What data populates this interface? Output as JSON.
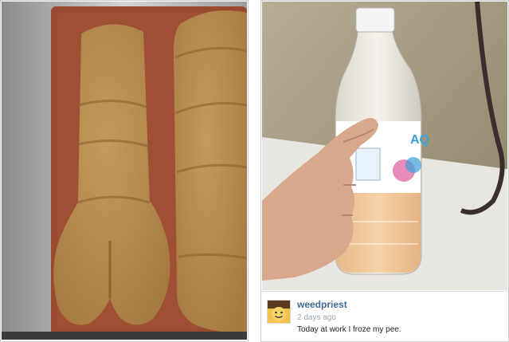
{
  "left_image": {
    "icon": "bread-loaves-photo",
    "colors": {
      "background": "#b9b9b9",
      "tray": "#9a4a2e",
      "crust": "#b8894d"
    }
  },
  "right_image": {
    "icon": "bottle-in-hand-photo",
    "colors": {
      "wall": "#a69a7e",
      "bottle_liquid": "#f0c79a",
      "label_accent": "#3aa0d8"
    }
  },
  "post": {
    "avatar_icon": "smiley-avatar-icon",
    "username": "weedpriest",
    "time_ago": "2 days ago",
    "caption": "Today at work I froze my pee."
  }
}
